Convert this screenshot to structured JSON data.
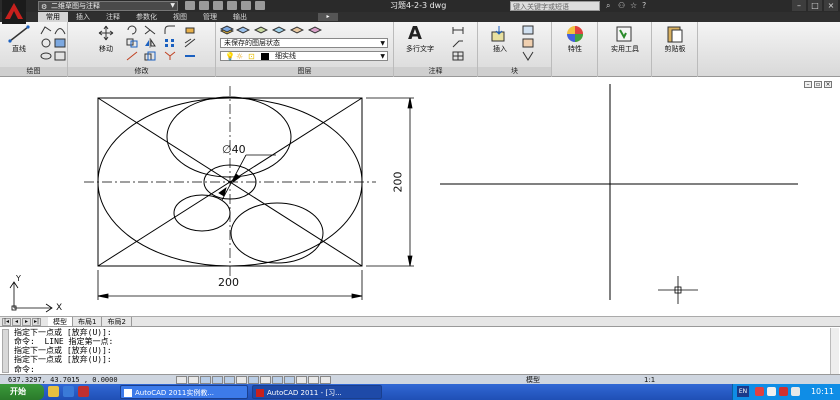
{
  "titlebar": {
    "workspace": "二维草图与注释",
    "doc_title": "习题4-2-3 dwg",
    "search_placeholder": "键入关键字或短语",
    "min": "–",
    "max": "□",
    "close": "×"
  },
  "tabs": [
    {
      "label": "常用"
    },
    {
      "label": "插入"
    },
    {
      "label": "注释"
    },
    {
      "label": "参数化"
    },
    {
      "label": "视图"
    },
    {
      "label": "管理"
    },
    {
      "label": "输出"
    }
  ],
  "ribbon": {
    "draw": {
      "label": "绘图",
      "line_label": "直线"
    },
    "modify": {
      "label": "修改",
      "move_label": "移动"
    },
    "layers": {
      "label": "图层",
      "state_combo": "未保存的图层状态",
      "layer_combo": "细实线"
    },
    "annotation": {
      "label": "注释",
      "mtext_label": "多行文字"
    },
    "block": {
      "label": "块",
      "insert_label": "插入"
    },
    "properties": {
      "label": "特性"
    },
    "utilities": {
      "label": "实用工具"
    },
    "clipboard": {
      "label": "剪贴板"
    }
  },
  "drawing": {
    "dim_diameter": "∅40",
    "dim_width": "200",
    "dim_height": "200",
    "ucs_x": "X",
    "ucs_y": "Y"
  },
  "layout_tabs": [
    {
      "label": "模型"
    },
    {
      "label": "布局1"
    },
    {
      "label": "布局2"
    }
  ],
  "command": {
    "lines": [
      "指定下一点或 [放弃(U)]:",
      "命令:  LINE 指定第一点:",
      "指定下一点或 [放弃(U)]:",
      "指定下一点或 [放弃(U)]:",
      "命令:"
    ]
  },
  "status": {
    "coords": "637.3297, 43.7015 , 0.0000",
    "model": "模型",
    "anno_scale": "1:1"
  },
  "taskbar": {
    "start": "开始",
    "tasks": [
      {
        "label": "AutoCAD 2011实例教..."
      },
      {
        "label": "AutoCAD 2011 - [习..."
      }
    ],
    "ime": "EN",
    "clock": "10:11"
  },
  "colors": {
    "titlebar_bg": "#2a2a2a",
    "ribbon_bg": "#e4e4e4",
    "taskbar_bg": "#245edb",
    "start_green": "#3a9a3a",
    "logo_red": "#c8201d"
  }
}
